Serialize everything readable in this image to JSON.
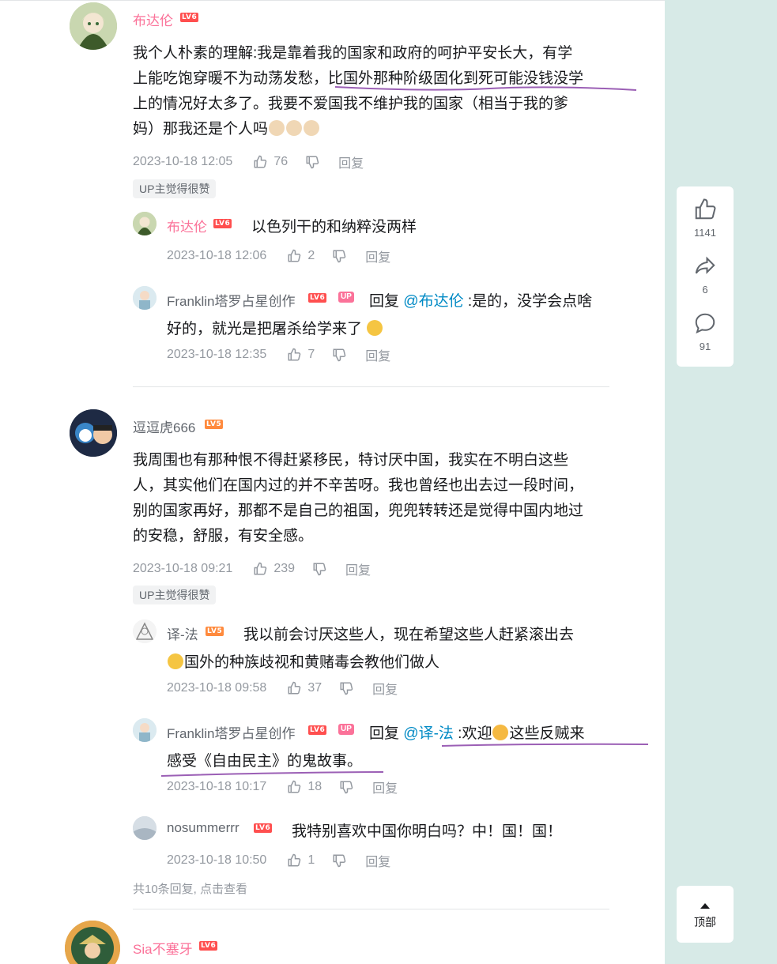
{
  "comments": [
    {
      "user": "布达伦",
      "level": "LV6",
      "lines": [
        "我个人朴素的理解:我是靠着我的国家和政府的呵护平安长大，有学",
        "上能吃饱穿暖不为动荡发愁，比国外那种阶级固化到死可能没钱没学",
        "上的情况好太多了。我要不爱国我不维护我的国家（相当于我的爹",
        "妈）那我还是个人吗"
      ],
      "date": "2023-10-18 12:05",
      "likes": "76",
      "reply_label": "回复",
      "tag": "UP主觉得很赞",
      "replies": [
        {
          "user": "布达伦",
          "level": "LV6",
          "text": "以色列干的和纳粹没两样",
          "date": "2023-10-18 12:06",
          "likes": "2"
        },
        {
          "user": "Franklin塔罗占星创作",
          "level": "LV6",
          "up": "UP",
          "prefix": "回复 ",
          "mention": "@布达伦",
          "text1": " :是的，没学会点啥",
          "text2": "好的，就光是把屠杀给学来了",
          "date": "2023-10-18 12:35",
          "likes": "7"
        }
      ]
    },
    {
      "user": "逗逗虎666",
      "level": "LV5",
      "lines": [
        "我周围也有那种恨不得赶紧移民，特讨厌中国，我实在不明白这些",
        "人，其实他们在国内过的并不辛苦呀。我也曾经也出去过一段时间，",
        "别的国家再好，那都不是自己的祖国，兜兜转转还是觉得中国内地过",
        "的安稳，舒服，有安全感。"
      ],
      "date": "2023-10-18 09:21",
      "likes": "239",
      "reply_label": "回复",
      "tag": "UP主觉得很赞",
      "replies": [
        {
          "user": "译-法",
          "level": "LV5",
          "text1": "我以前会讨厌这些人，现在希望这些人赶紧滚出去",
          "text2": "国外的种族歧视和黄赌毒会教他们做人",
          "date": "2023-10-18 09:58",
          "likes": "37"
        },
        {
          "user": "Franklin塔罗占星创作",
          "level": "LV6",
          "up": "UP",
          "prefix": "回复 ",
          "mention": "@译-法",
          "text1a": " :欢迎",
          "text1b": "这些反贼来",
          "text2": "感受《自由民主》的鬼故事。",
          "date": "2023-10-18 10:17",
          "likes": "18"
        },
        {
          "user": "nosummerrr",
          "level": "LV6",
          "text": "我特别喜欢中国你明白吗？中！国！国！",
          "date": "2023-10-18 10:50",
          "likes": "1"
        }
      ],
      "more": "共10条回复, 点击查看"
    },
    {
      "user": "Sia不塞牙",
      "level": "LV6"
    }
  ],
  "sidebar": {
    "like_count": "1141",
    "share_count": "6",
    "comment_count": "91",
    "top_label": "顶部"
  },
  "colors": {
    "username_pink": "#fb7299",
    "mention_blue": "#008ac5",
    "meta_gray": "#9499a0",
    "aside_bg": "#d7eae7",
    "annotation_purple": "#9b5fb5"
  },
  "icons": [
    "thumbs-up-icon",
    "thumbs-down-icon",
    "share-icon",
    "comment-icon",
    "caret-up-icon"
  ]
}
